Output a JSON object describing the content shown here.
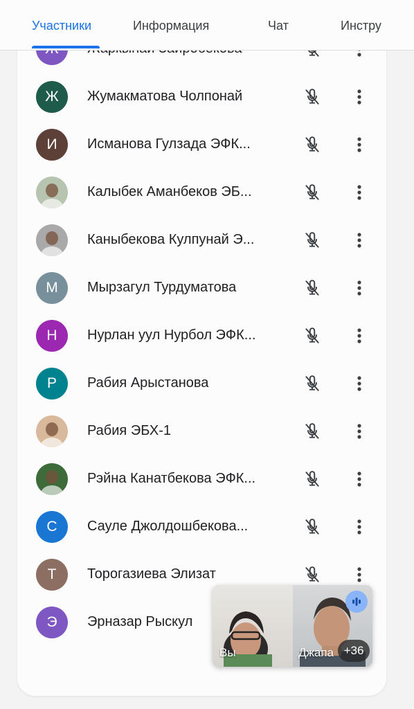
{
  "tabs": [
    {
      "label": "Участники"
    },
    {
      "label": "Информация"
    },
    {
      "label": "Чат"
    },
    {
      "label": "Инстру"
    }
  ],
  "participants": [
    {
      "initial": "Ж",
      "name": "Жаркынай Заиробекова",
      "color": "#7e57c2"
    },
    {
      "initial": "Ж",
      "name": "Жумакматова Чолпонай",
      "color": "#1e5b4a"
    },
    {
      "initial": "И",
      "name": "Исманова Гулзада ЭФК...",
      "color": "#5d4037"
    },
    {
      "initial": "",
      "name": "Калыбек Аманбеков ЭБ...",
      "color": "#b7c4b0",
      "photo": true
    },
    {
      "initial": "",
      "name": "Каныбекова Кулпунай Э...",
      "color": "#a9a9a9",
      "photo": true
    },
    {
      "initial": "М",
      "name": "Мырзагул Турдуматова",
      "color": "#78909c"
    },
    {
      "initial": "Н",
      "name": "Нурлан уул Нурбол ЭФК...",
      "color": "#9c27b0"
    },
    {
      "initial": "Р",
      "name": "Рабия Арыстанова",
      "color": "#00838f"
    },
    {
      "initial": "",
      "name": "Рабия ЭБХ-1",
      "color": "#d9b99b",
      "photo": true
    },
    {
      "initial": "",
      "name": "Рэйна Канатбекова ЭФК...",
      "color": "#3e6b3a",
      "photo": true
    },
    {
      "initial": "С",
      "name": "Сауле Джолдошбекова...",
      "color": "#1976d2"
    },
    {
      "initial": "Т",
      "name": "Торогазиева Элизат",
      "color": "#8d6e63"
    },
    {
      "initial": "Э",
      "name": "Эрназар Рыскул",
      "color": "#7e57c2"
    }
  ],
  "pip": {
    "self_label": "Вы",
    "other_label": "Джапа",
    "extra_count": "+36"
  }
}
